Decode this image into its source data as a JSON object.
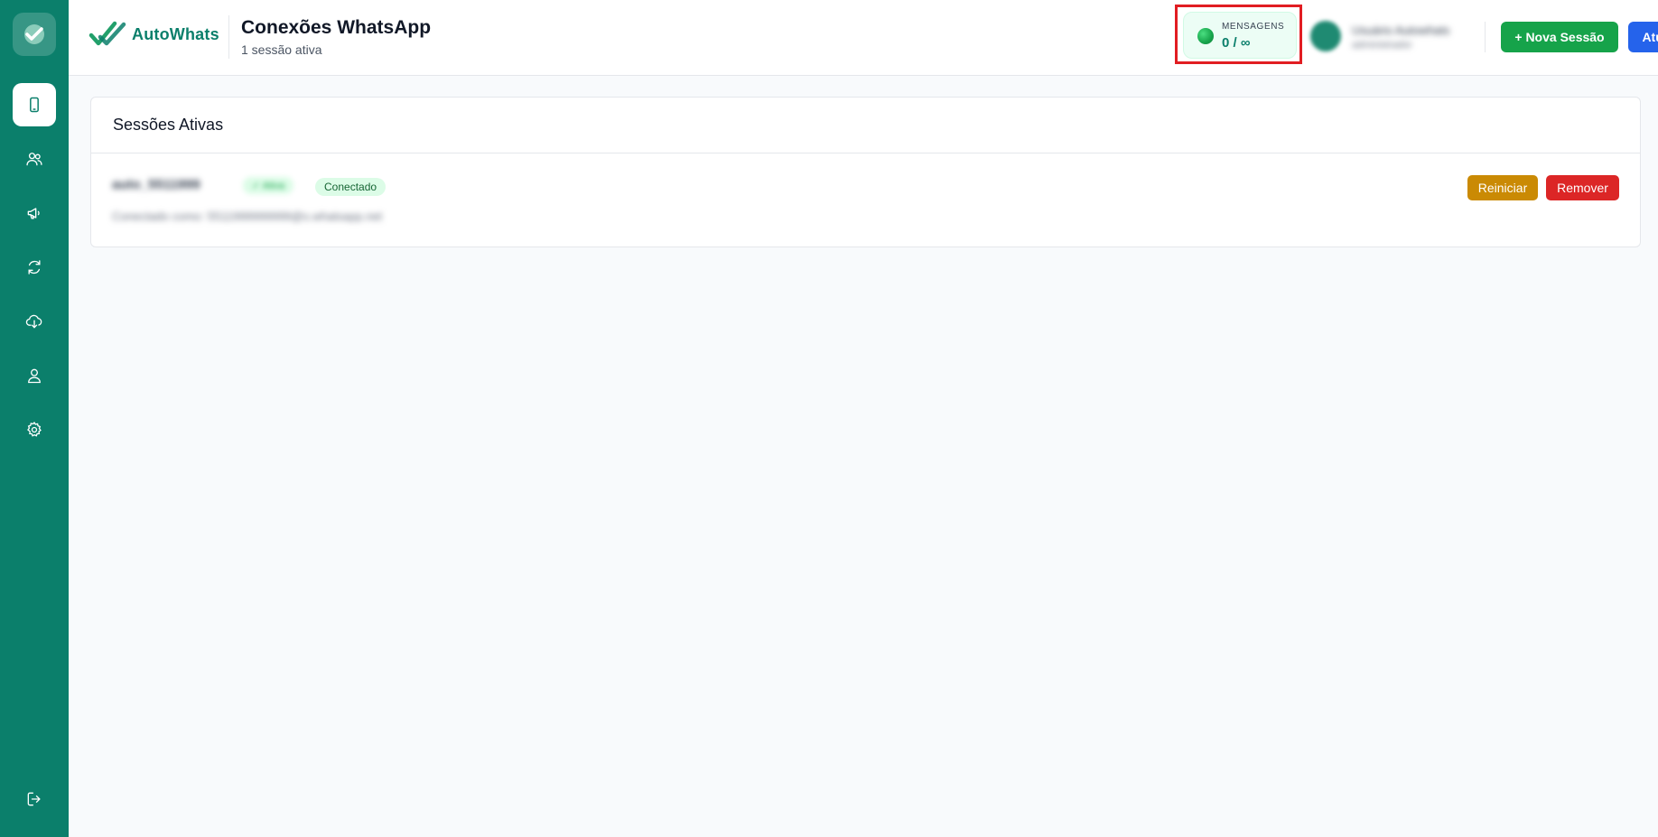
{
  "brand": {
    "name": "AutoWhats"
  },
  "header": {
    "title": "Conexões WhatsApp",
    "subtitle": "1 sessão ativa",
    "messages": {
      "label": "MENSAGENS",
      "value": "0 / ∞"
    },
    "user": {
      "name": "Usuário Autowhats",
      "role": "administrador"
    },
    "new_session_label": "+ Nova Sessão",
    "refresh_label": "Atualizar"
  },
  "sidebar": {
    "items": [
      {
        "icon": "phone-icon",
        "active": true
      },
      {
        "icon": "users-icon",
        "active": false
      },
      {
        "icon": "megaphone-icon",
        "active": false
      },
      {
        "icon": "refresh-icon",
        "active": false
      },
      {
        "icon": "cloud-download-icon",
        "active": false
      },
      {
        "icon": "user-icon",
        "active": false
      },
      {
        "icon": "gear-icon",
        "active": false
      }
    ],
    "logout_icon": "logout-icon"
  },
  "sessions_panel": {
    "title": "Sessões Ativas",
    "sessions": [
      {
        "name": "auto_5511999",
        "tag": "✓ Ativa",
        "status": "Conectado",
        "description": "Conectado como: 5511999999999@s.whatsapp.net",
        "restart_label": "Reiniciar",
        "remove_label": "Remover"
      }
    ]
  },
  "colors": {
    "primary": "#0b7f6b",
    "success": "#16a34a",
    "info": "#2563eb",
    "warning": "#ca8a04",
    "danger": "#dc2626",
    "highlight": "#e11d22"
  }
}
